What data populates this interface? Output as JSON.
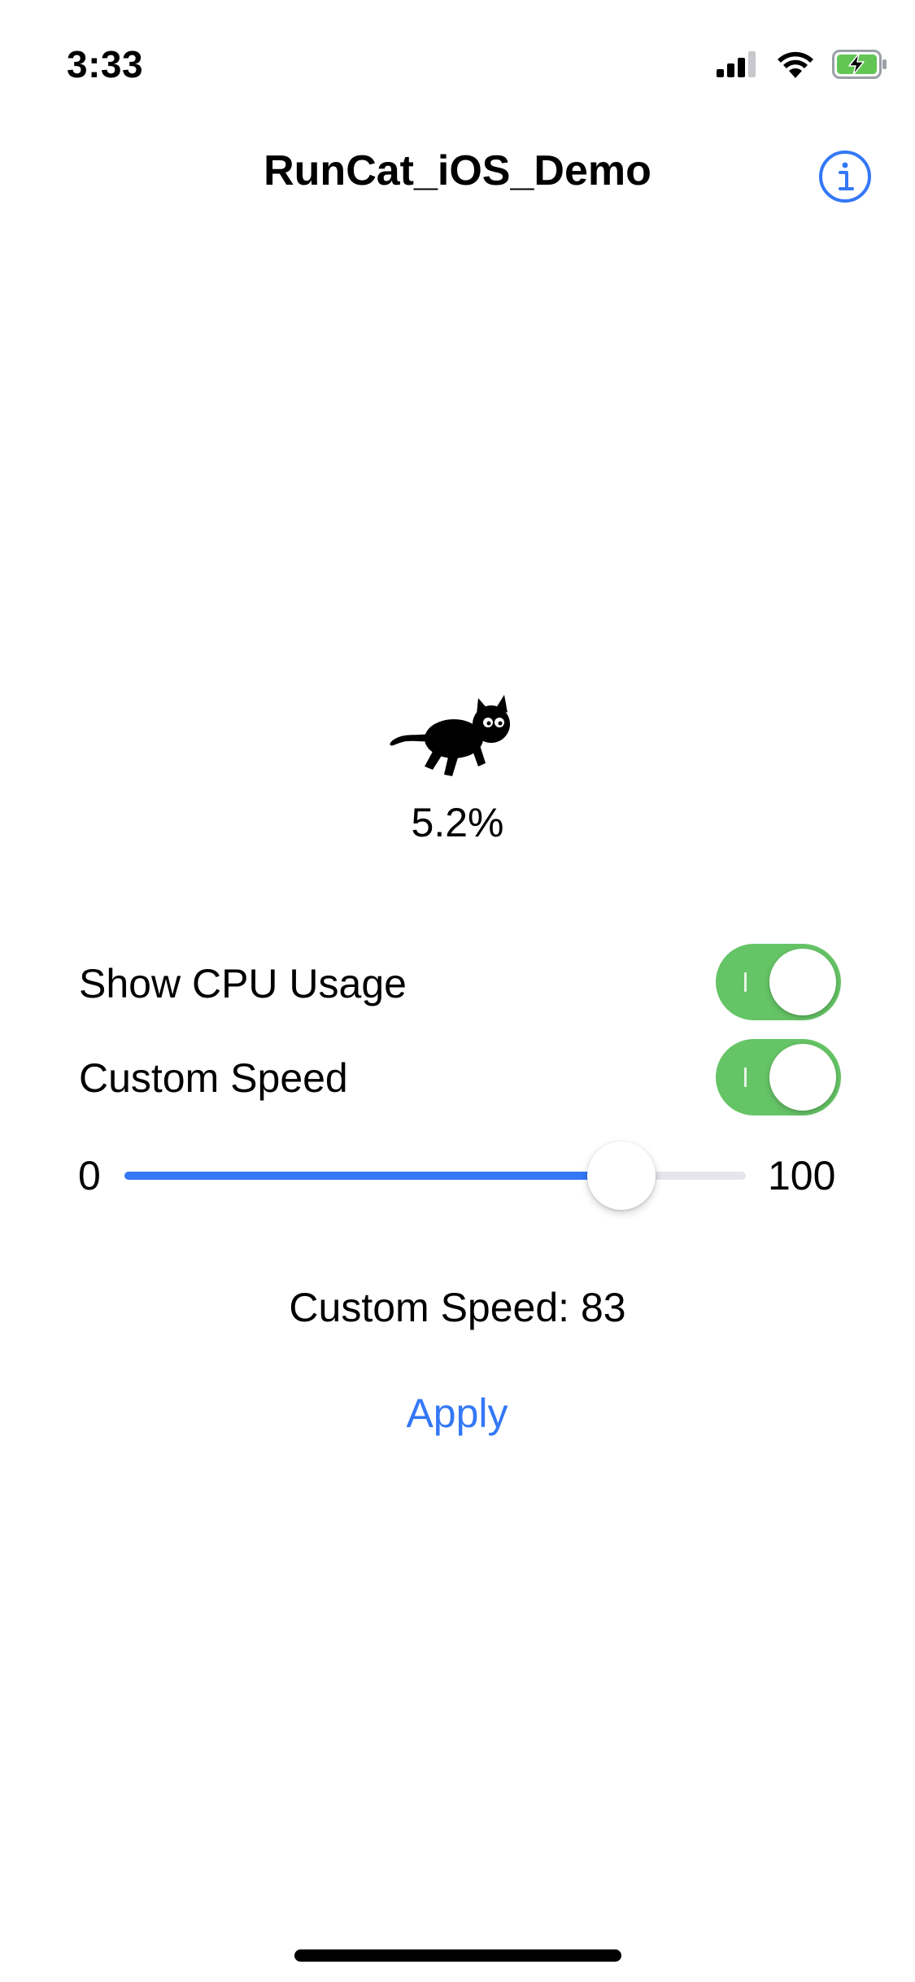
{
  "status_bar": {
    "time": "3:33",
    "icons": [
      "cellular-signal-icon",
      "wifi-icon",
      "battery-charging-icon"
    ]
  },
  "nav": {
    "title": "RunCat_iOS_Demo",
    "info_icon": "info-circle-icon"
  },
  "runner": {
    "icon": "running-cat-icon",
    "cpu_usage": "5.2%"
  },
  "settings": {
    "show_cpu_usage": {
      "label": "Show CPU Usage",
      "on": true
    },
    "custom_speed": {
      "label": "Custom Speed",
      "on": true
    }
  },
  "slider": {
    "min_label": "0",
    "max_label": "100",
    "min": 0,
    "max": 100,
    "value": 80
  },
  "speed_readout": "Custom Speed: 83",
  "apply_label": "Apply",
  "colors": {
    "accent": "#3478f6",
    "toggle_on": "#65c466",
    "track": "#e5e5ea"
  }
}
